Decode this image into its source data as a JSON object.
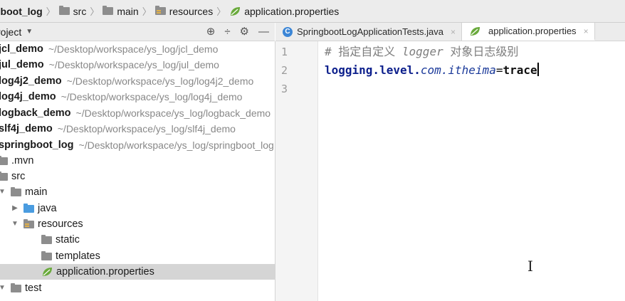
{
  "breadcrumb": [
    "gboot_log",
    "src",
    "main",
    "resources",
    "application.properties"
  ],
  "project_panel": {
    "title": "roject",
    "tools": [
      "crosshair-icon",
      "collapse-icon",
      "gear-icon",
      "minimize-icon"
    ]
  },
  "tree": {
    "modules": [
      {
        "name": "jcl_demo",
        "path": "~/Desktop/workspace/ys_log/jcl_demo"
      },
      {
        "name": "jul_demo",
        "path": "~/Desktop/workspace/ys_log/jul_demo"
      },
      {
        "name": "log4j2_demo",
        "path": "~/Desktop/workspace/ys_log/log4j2_demo"
      },
      {
        "name": "log4j_demo",
        "path": "~/Desktop/workspace/ys_log/log4j_demo"
      },
      {
        "name": "logback_demo",
        "path": "~/Desktop/workspace/ys_log/logback_demo"
      },
      {
        "name": "slf4j_demo",
        "path": "~/Desktop/workspace/ys_log/slf4j_demo"
      },
      {
        "name": "springboot_log",
        "path": "~/Desktop/workspace/ys_log/springboot_log"
      }
    ],
    "items": {
      "mvn": ".mvn",
      "src": "src",
      "main": "main",
      "java": "java",
      "resources": "resources",
      "static": "static",
      "templates": "templates",
      "properties": "application.properties",
      "test": "test"
    }
  },
  "tabs": [
    {
      "label": "SpringbootLogApplicationTests.java",
      "icon": "class-icon"
    },
    {
      "label": "application.properties",
      "icon": "spring-leaf-icon"
    }
  ],
  "editor": {
    "line_numbers": [
      "1",
      "2",
      "3"
    ],
    "comment_prefix": "# 指定自定义 ",
    "comment_italic": "logger",
    "comment_suffix": " 对象日志级别",
    "key_prefix": "logging.level.",
    "key_italic": "com.itheima",
    "equals": "=",
    "value": "trace"
  }
}
